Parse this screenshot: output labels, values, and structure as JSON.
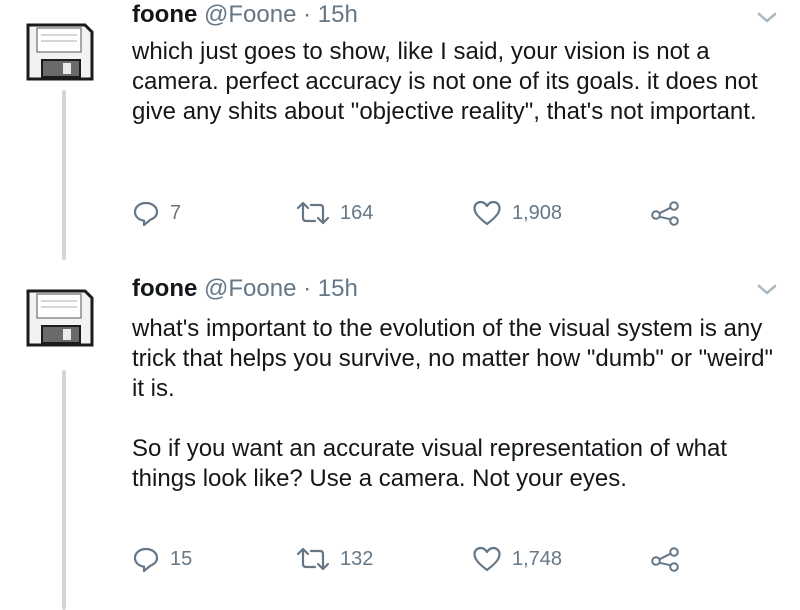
{
  "tweets": [
    {
      "name": "foone",
      "handle": "@Foone",
      "separator": "·",
      "time": "15h",
      "paragraphs": [
        "which just goes to show, like I said, your vision is not a camera. perfect accuracy is not one of its goals. it does not give any shits about \"objective reality\", that's not important."
      ],
      "replies": "7",
      "retweets": "164",
      "likes": "1,908"
    },
    {
      "name": "foone",
      "handle": "@Foone",
      "separator": "·",
      "time": "15h",
      "paragraphs": [
        "what's important to the evolution of the visual system is any trick that helps you survive, no matter how \"dumb\" or \"weird\" it is.",
        "So if you want an accurate visual representation of what things look like? Use a camera. Not your eyes."
      ],
      "replies": "15",
      "retweets": "132",
      "likes": "1,748"
    }
  ],
  "icons": {
    "avatar": "floppy-disk-icon",
    "menu": "chevron-down-icon",
    "reply": "reply-icon",
    "retweet": "retweet-icon",
    "like": "heart-icon",
    "share": "share-icon"
  },
  "colors": {
    "text": "#14171a",
    "muted": "#657786",
    "thread_line": "#d0d6db"
  }
}
